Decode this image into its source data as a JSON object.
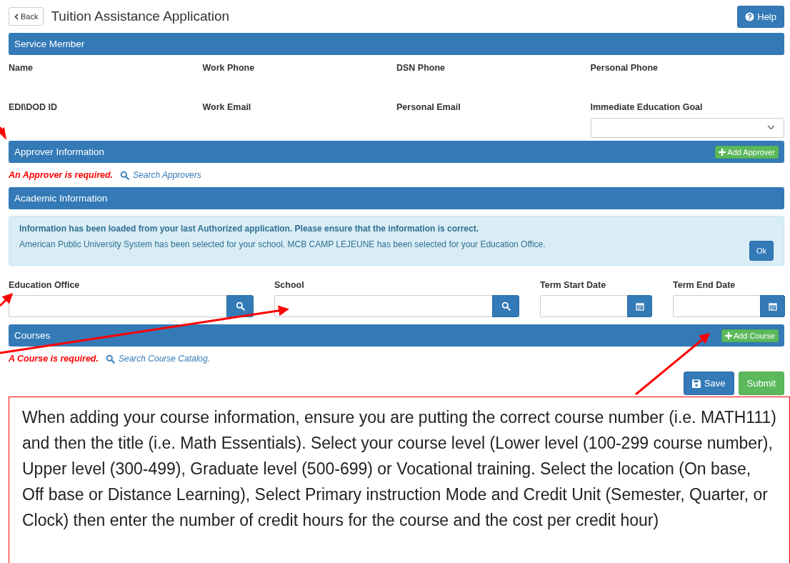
{
  "header": {
    "back": "Back",
    "title": "Tuition Assistance Application",
    "help": "Help"
  },
  "service_member": {
    "title": "Service Member",
    "fields": [
      {
        "label": "Name",
        "kind": "text"
      },
      {
        "label": "Work Phone",
        "kind": "text"
      },
      {
        "label": "DSN Phone",
        "kind": "text"
      },
      {
        "label": "Personal Phone",
        "kind": "text"
      },
      {
        "label": "EDI\\DOD ID",
        "kind": "text"
      },
      {
        "label": "Work Email",
        "kind": "text"
      },
      {
        "label": "Personal Email",
        "kind": "text"
      },
      {
        "label": "Immediate Education Goal",
        "kind": "dropdown"
      }
    ]
  },
  "approver": {
    "title": "Approver Information",
    "add_button": "Add Approver",
    "error": "An Approver is required.",
    "search_link": "Search Approvers"
  },
  "academic": {
    "title": "Academic Information",
    "alert": {
      "heading": "Information has been loaded from your last Authorized application. Please ensure that the information is correct.",
      "message": "American Public University System has been selected for your school. MCB CAMP LEJEUNE has been selected for your Education Office.",
      "button": "Ok"
    },
    "fields": [
      {
        "label": "Education Office",
        "kind": "search"
      },
      {
        "label": "School",
        "kind": "search"
      },
      {
        "label": "Term Start Date",
        "kind": "date"
      },
      {
        "label": "Term End Date",
        "kind": "date"
      }
    ]
  },
  "courses": {
    "title": "Courses",
    "add_button": "Add Course",
    "error": "A Course is required.",
    "search_link": "Search Course Catalog."
  },
  "actions": [
    {
      "label": "Save",
      "kind": "save"
    },
    {
      "label": "Submit",
      "kind": "submit"
    }
  ],
  "callout": {
    "text": "When adding your course information, ensure you are putting the correct course number (i.e. MATH111) and then the title (i.e. Math Essentials).  Select your course level (Lower level (100-299 course number), Upper level (300-499), Graduate level (500-699) or Vocational training.  Select the location (On base, Off base or Distance Learning), Select Primary instruction Mode and Credit Unit (Semester, Quarter, or Clock) then enter the number of credit hours for the course and the cost per credit hour)"
  }
}
